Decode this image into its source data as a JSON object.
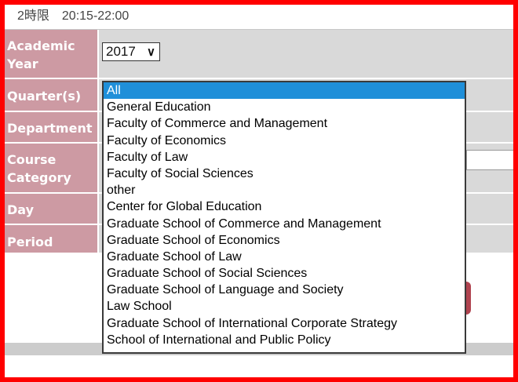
{
  "header": {
    "period_time": "2時限　20:15-22:00"
  },
  "form": {
    "academic_year_label": "Academic Year",
    "academic_year_value": "2017",
    "quarters_label": "Quarter(s)",
    "department_label": "Department",
    "course_category_label": "Course Category",
    "day_label": "Day",
    "period_label": "Period"
  },
  "dropdown": {
    "options": [
      "All",
      "General Education",
      "Faculty of Commerce and Management",
      "Faculty of Economics",
      "Faculty of Law",
      "Faculty of Social Sciences",
      "other",
      "Center for Global Education",
      "Graduate School of Commerce and Management",
      "Graduate School of Economics",
      "Graduate School of Law",
      "Graduate School of Social Sciences",
      "Graduate School of Language and Society",
      "Law School",
      "Graduate School of International Corporate Strategy",
      "School of International and Public Policy"
    ],
    "selected_index": 0
  },
  "colors": {
    "label_bg": "#cd9aa3",
    "field_bg": "#d9d9d9",
    "highlight": "#1f8fd9",
    "frame": "#ff0000",
    "button": "#b0434f"
  }
}
